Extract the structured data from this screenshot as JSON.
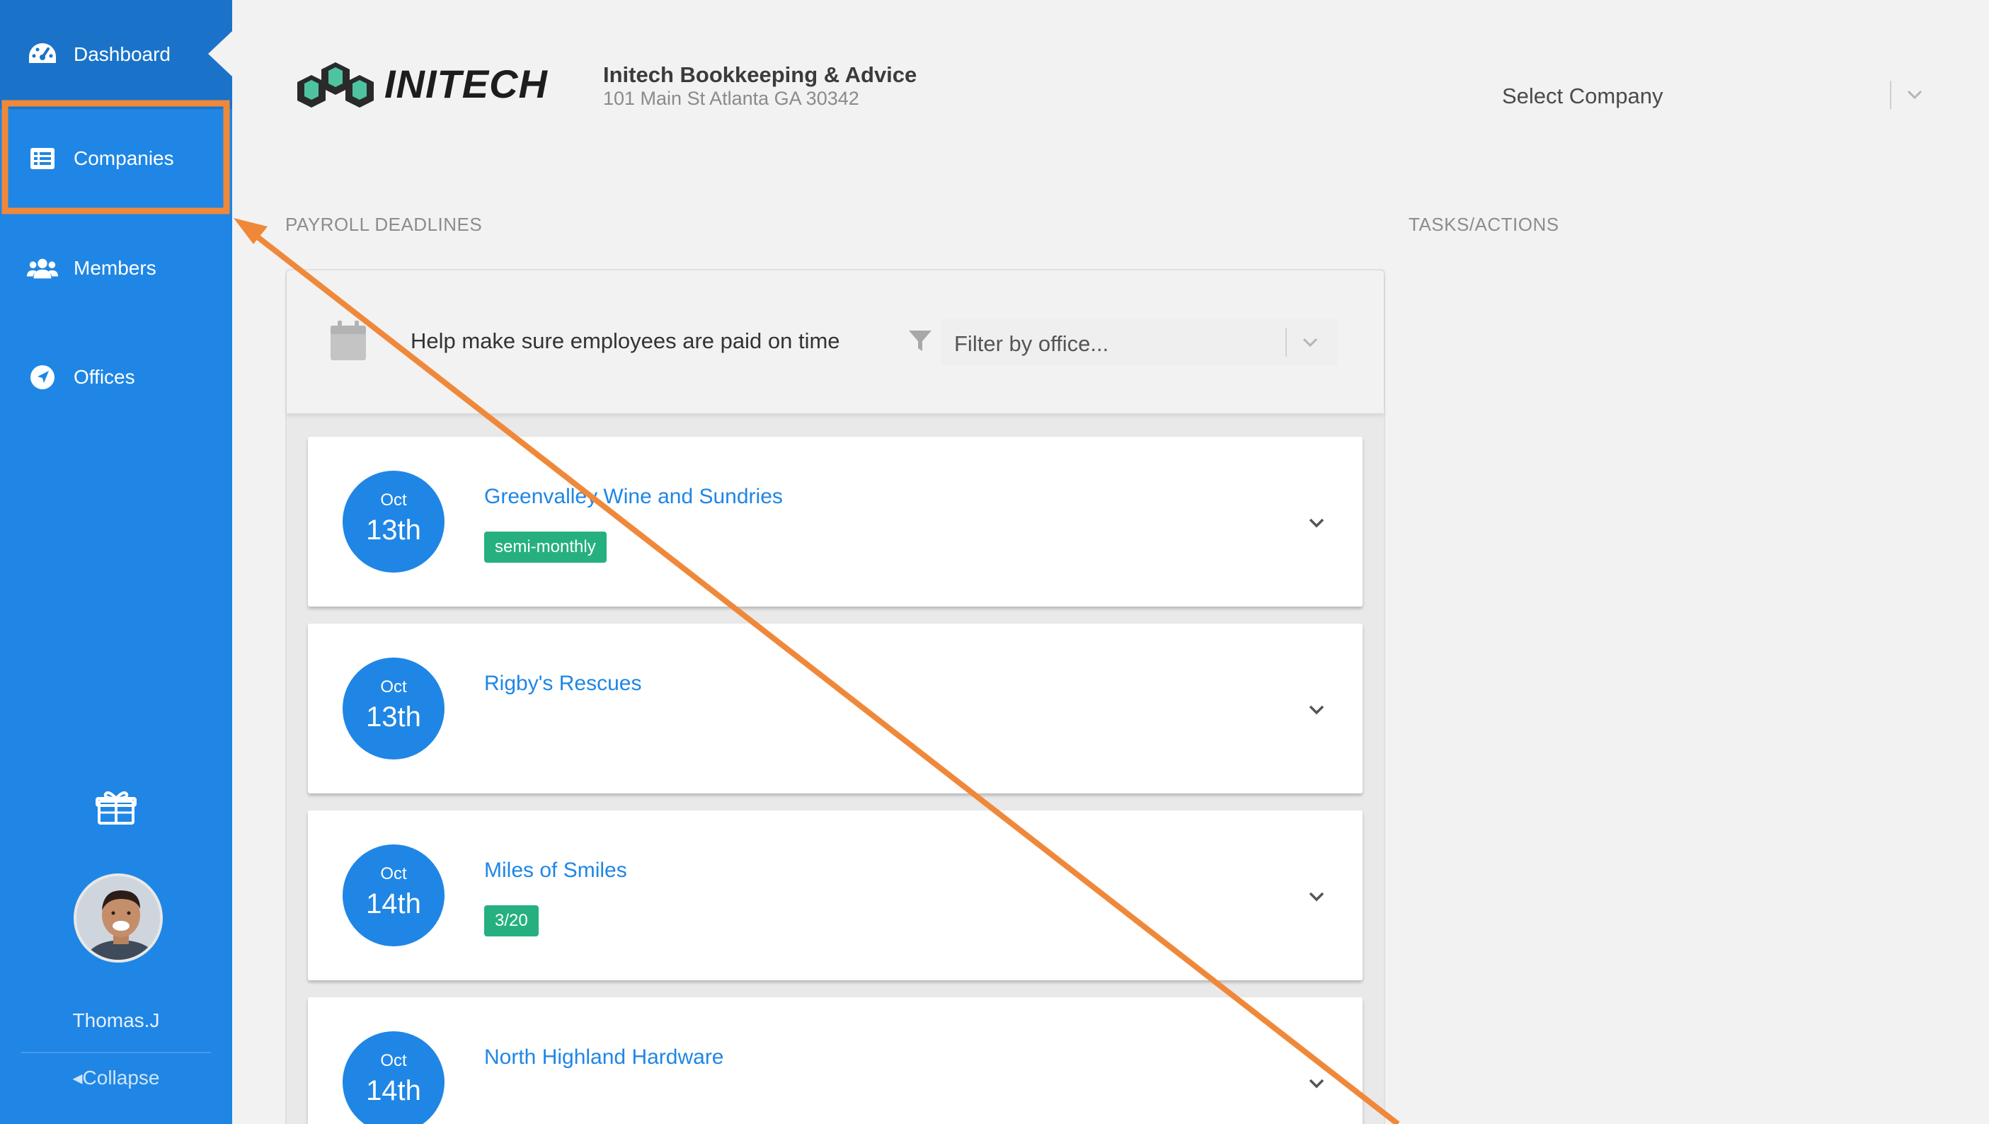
{
  "sidebar": {
    "items": [
      {
        "label": "Dashboard",
        "icon": "dashboard-icon",
        "active": true
      },
      {
        "label": "Companies",
        "icon": "list-icon",
        "active": false
      },
      {
        "label": "Members",
        "icon": "users-icon",
        "active": false
      },
      {
        "label": "Offices",
        "icon": "location-arrow-icon",
        "active": false
      }
    ],
    "gift_icon": "gift-icon",
    "user_name": "Thomas.J",
    "collapse_label": "Collapse"
  },
  "header": {
    "logo_text": "INITECH",
    "org_name": "Initech Bookkeeping & Advice",
    "org_address": "101 Main St Atlanta GA 30342",
    "company_select_placeholder": "Select Company"
  },
  "sections": {
    "payroll_label": "PAYROLL DEADLINES",
    "tasks_label": "TASKS/ACTIONS"
  },
  "payroll": {
    "title": "Help make sure employees are paid on time",
    "filter_placeholder": "Filter by office...",
    "deadlines": [
      {
        "month": "Oct",
        "day": "13th",
        "company": "Greenvalley Wine and Sundries",
        "badge": "semi-monthly"
      },
      {
        "month": "Oct",
        "day": "13th",
        "company": "Rigby's Rescues",
        "badge": ""
      },
      {
        "month": "Oct",
        "day": "14th",
        "company": "Miles of Smiles",
        "badge": "3/20"
      },
      {
        "month": "Oct",
        "day": "14th",
        "company": "North Highland Hardware",
        "badge": ""
      }
    ]
  },
  "colors": {
    "sidebar": "#1f86e5",
    "sidebar_active": "#1a73c9",
    "accent": "#1f86e5",
    "badge": "#26b07f",
    "annotation": "#f0883a"
  }
}
